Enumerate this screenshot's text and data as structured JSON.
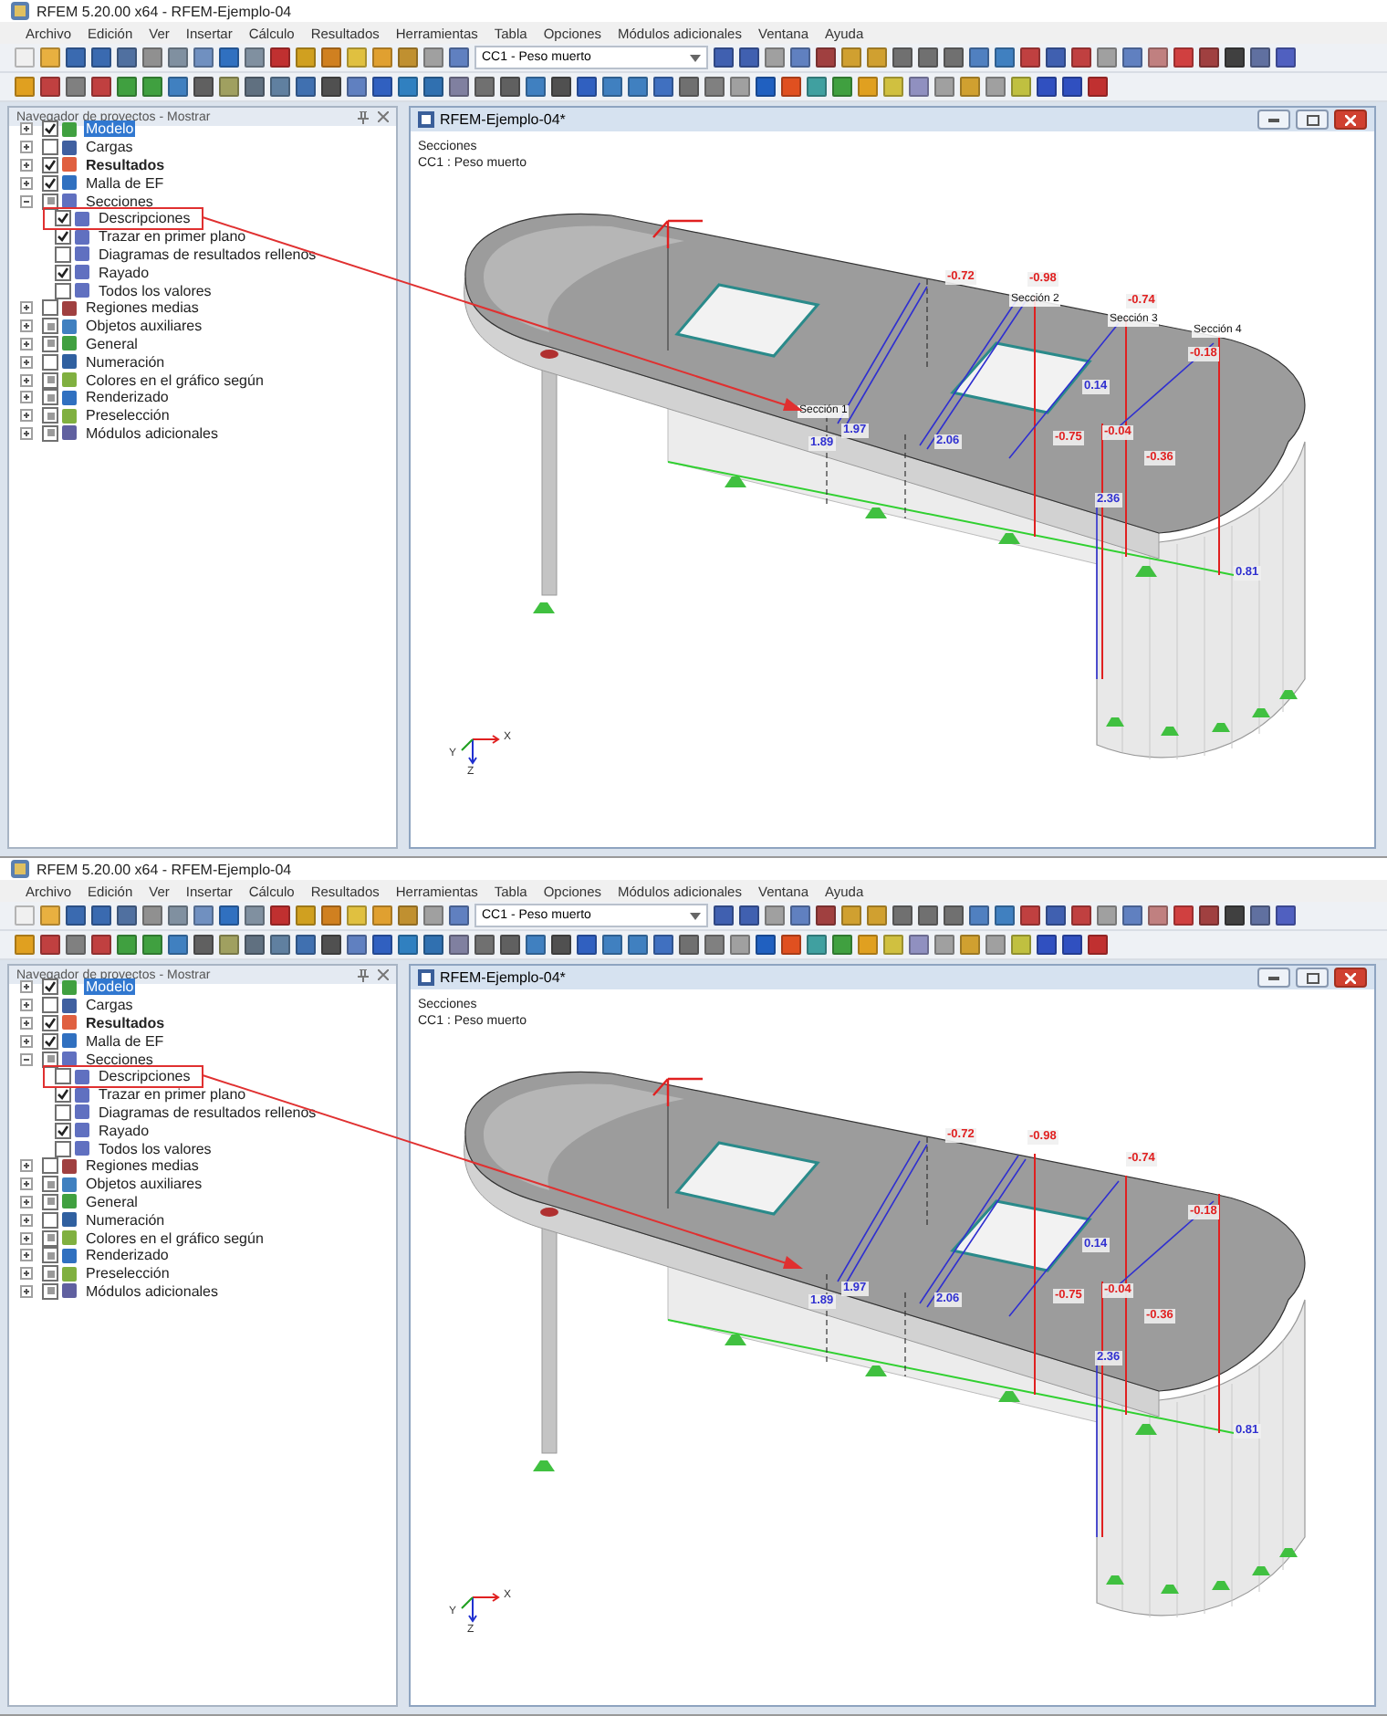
{
  "screens": [
    {
      "title": "RFEM 5.20.00 x64 - RFEM-Ejemplo-04",
      "menu": [
        "Archivo",
        "Edición",
        "Ver",
        "Insertar",
        "Cálculo",
        "Resultados",
        "Herramientas",
        "Tabla",
        "Opciones",
        "Módulos adicionales",
        "Ventana",
        "Ayuda"
      ],
      "load_case": "CC1 - Peso muerto",
      "navigator": {
        "title": "Navegador de proyectos - Mostrar",
        "items": [
          {
            "label": "Modelo",
            "checked": true,
            "mixed": false,
            "selected": true,
            "bold": false,
            "expanded": false
          },
          {
            "label": "Cargas",
            "checked": false,
            "mixed": false,
            "selected": false,
            "bold": false,
            "expanded": false
          },
          {
            "label": "Resultados",
            "checked": true,
            "mixed": false,
            "selected": false,
            "bold": true,
            "expanded": false
          },
          {
            "label": "Malla de EF",
            "checked": true,
            "mixed": false,
            "selected": false,
            "bold": false,
            "expanded": false
          },
          {
            "label": "Secciones",
            "checked": true,
            "mixed": true,
            "selected": false,
            "bold": false,
            "expanded": true,
            "children": [
              {
                "label": "Descripciones",
                "checked": true,
                "selected": false
              },
              {
                "label": "Trazar en primer plano",
                "checked": true,
                "selected": false
              },
              {
                "label": "Diagramas de resultados rellenos",
                "checked": false,
                "selected": false
              },
              {
                "label": "Rayado",
                "checked": true,
                "selected": false
              },
              {
                "label": "Todos los valores",
                "checked": false,
                "selected": false
              }
            ]
          },
          {
            "label": "Regiones medias",
            "checked": false,
            "mixed": false,
            "selected": false,
            "bold": false,
            "expanded": false
          },
          {
            "label": "Objetos auxiliares",
            "checked": true,
            "mixed": true,
            "selected": false,
            "bold": false,
            "expanded": false
          },
          {
            "label": "General",
            "checked": true,
            "mixed": true,
            "selected": false,
            "bold": false,
            "expanded": false
          },
          {
            "label": "Numeración",
            "checked": false,
            "mixed": false,
            "selected": false,
            "bold": false,
            "expanded": false
          },
          {
            "label": "Colores en el gráfico según",
            "checked": true,
            "mixed": true,
            "selected": false,
            "bold": false,
            "expanded": false
          },
          {
            "label": "Renderizado",
            "checked": true,
            "mixed": true,
            "selected": false,
            "bold": false,
            "expanded": false
          },
          {
            "label": "Preselección",
            "checked": true,
            "mixed": true,
            "selected": false,
            "bold": false,
            "expanded": false
          },
          {
            "label": "Módulos adicionales",
            "checked": true,
            "mixed": true,
            "selected": false,
            "bold": false,
            "expanded": false
          }
        ]
      },
      "view": {
        "title": "RFEM-Ejemplo-04*",
        "heading": "Secciones",
        "subheading": "CC1 : Peso muerto",
        "value_labels": [
          {
            "text": "-0.72",
            "color": "#e02020"
          },
          {
            "text": "-0.98",
            "color": "#e02020"
          },
          {
            "text": "-0.74",
            "color": "#e02020"
          },
          {
            "text": "-0.18",
            "color": "#e02020"
          },
          {
            "text": "0.14",
            "color": "#3030d0"
          },
          {
            "text": "1.97",
            "color": "#3030d0"
          },
          {
            "text": "1.89",
            "color": "#3030d0"
          },
          {
            "text": "2.06",
            "color": "#3030d0"
          },
          {
            "text": "-0.75",
            "color": "#e02020"
          },
          {
            "text": "-0.04",
            "color": "#e02020"
          },
          {
            "text": "-0.36",
            "color": "#e02020"
          },
          {
            "text": "2.36",
            "color": "#3030d0"
          },
          {
            "text": "0.81",
            "color": "#3030d0"
          }
        ],
        "section_labels": [
          "Sección 1",
          "Sección 2",
          "Sección 3",
          "Sección 4"
        ],
        "axes": [
          "X",
          "Y",
          "Z"
        ]
      }
    },
    {
      "title": "RFEM 5.20.00 x64 - RFEM-Ejemplo-04",
      "menu": [
        "Archivo",
        "Edición",
        "Ver",
        "Insertar",
        "Cálculo",
        "Resultados",
        "Herramientas",
        "Tabla",
        "Opciones",
        "Módulos adicionales",
        "Ventana",
        "Ayuda"
      ],
      "load_case": "CC1 - Peso muerto",
      "navigator": {
        "title": "Navegador de proyectos - Mostrar",
        "items": [
          {
            "label": "Modelo",
            "checked": true,
            "mixed": false,
            "selected": true,
            "bold": false,
            "expanded": false
          },
          {
            "label": "Cargas",
            "checked": false,
            "mixed": false,
            "selected": false,
            "bold": false,
            "expanded": false
          },
          {
            "label": "Resultados",
            "checked": true,
            "mixed": false,
            "selected": false,
            "bold": true,
            "expanded": false
          },
          {
            "label": "Malla de EF",
            "checked": true,
            "mixed": false,
            "selected": false,
            "bold": false,
            "expanded": false
          },
          {
            "label": "Secciones",
            "checked": true,
            "mixed": true,
            "selected": false,
            "bold": false,
            "expanded": true,
            "children": [
              {
                "label": "Descripciones",
                "checked": false,
                "selected": false
              },
              {
                "label": "Trazar en primer plano",
                "checked": true,
                "selected": false
              },
              {
                "label": "Diagramas de resultados rellenos",
                "checked": false,
                "selected": false
              },
              {
                "label": "Rayado",
                "checked": true,
                "selected": false
              },
              {
                "label": "Todos los valores",
                "checked": false,
                "selected": false
              }
            ]
          },
          {
            "label": "Regiones medias",
            "checked": false,
            "mixed": false,
            "selected": false,
            "bold": false,
            "expanded": false
          },
          {
            "label": "Objetos auxiliares",
            "checked": true,
            "mixed": true,
            "selected": false,
            "bold": false,
            "expanded": false
          },
          {
            "label": "General",
            "checked": true,
            "mixed": true,
            "selected": false,
            "bold": false,
            "expanded": false
          },
          {
            "label": "Numeración",
            "checked": false,
            "mixed": false,
            "selected": false,
            "bold": false,
            "expanded": false
          },
          {
            "label": "Colores en el gráfico según",
            "checked": true,
            "mixed": true,
            "selected": false,
            "bold": false,
            "expanded": false
          },
          {
            "label": "Renderizado",
            "checked": true,
            "mixed": true,
            "selected": false,
            "bold": false,
            "expanded": false
          },
          {
            "label": "Preselección",
            "checked": true,
            "mixed": true,
            "selected": false,
            "bold": false,
            "expanded": false
          },
          {
            "label": "Módulos adicionales",
            "checked": true,
            "mixed": true,
            "selected": false,
            "bold": false,
            "expanded": false
          }
        ]
      },
      "view": {
        "title": "RFEM-Ejemplo-04*",
        "heading": "Secciones",
        "subheading": "CC1 : Peso muerto",
        "value_labels": [
          {
            "text": "-0.72",
            "color": "#e02020"
          },
          {
            "text": "-0.98",
            "color": "#e02020"
          },
          {
            "text": "-0.74",
            "color": "#e02020"
          },
          {
            "text": "-0.18",
            "color": "#e02020"
          },
          {
            "text": "0.14",
            "color": "#3030d0"
          },
          {
            "text": "1.97",
            "color": "#3030d0"
          },
          {
            "text": "1.89",
            "color": "#3030d0"
          },
          {
            "text": "2.06",
            "color": "#3030d0"
          },
          {
            "text": "-0.75",
            "color": "#e02020"
          },
          {
            "text": "-0.04",
            "color": "#e02020"
          },
          {
            "text": "-0.36",
            "color": "#e02020"
          },
          {
            "text": "2.36",
            "color": "#3030d0"
          },
          {
            "text": "0.81",
            "color": "#3030d0"
          }
        ],
        "axes": [
          "X",
          "Y",
          "Z"
        ]
      }
    }
  ]
}
